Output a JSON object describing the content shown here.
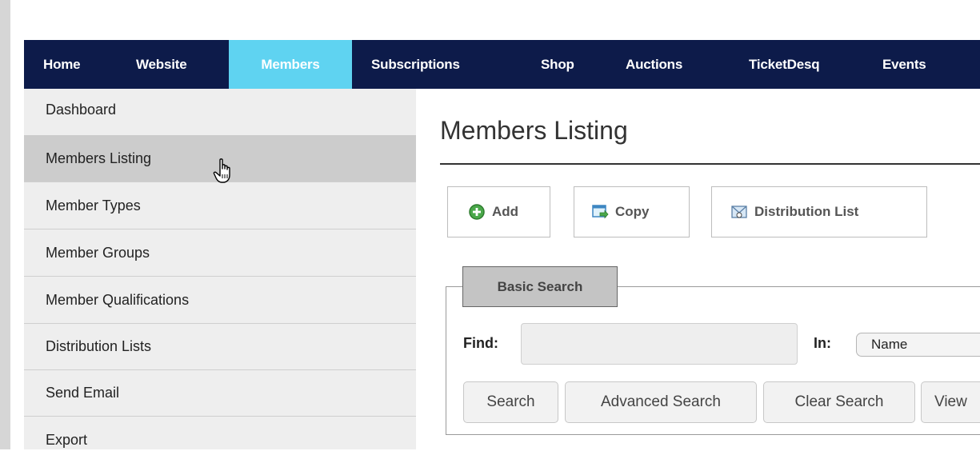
{
  "nav": {
    "items": [
      {
        "label": "Home",
        "active": false
      },
      {
        "label": "Website",
        "active": false
      },
      {
        "label": "Members",
        "active": true
      },
      {
        "label": "Subscriptions",
        "active": false
      },
      {
        "label": "Shop",
        "active": false
      },
      {
        "label": "Auctions",
        "active": false
      },
      {
        "label": "TicketDesq",
        "active": false
      },
      {
        "label": "Events",
        "active": false
      }
    ]
  },
  "sidebar": {
    "items": [
      {
        "label": "Dashboard"
      },
      {
        "label": "Members Listing",
        "active": true
      },
      {
        "label": "Member Types"
      },
      {
        "label": "Member Groups"
      },
      {
        "label": "Member Qualifications"
      },
      {
        "label": "Distribution Lists"
      },
      {
        "label": "Send Email"
      },
      {
        "label": "Export"
      }
    ]
  },
  "main": {
    "title": "Members Listing",
    "toolbar": {
      "add": "Add",
      "copy": "Copy",
      "distribution_list": "Distribution List"
    },
    "search": {
      "legend": "Basic Search",
      "find_label": "Find:",
      "find_value": "",
      "in_label": "In:",
      "in_value": "Name",
      "buttons": {
        "search": "Search",
        "advanced": "Advanced Search",
        "clear": "Clear Search",
        "view": "View"
      }
    }
  },
  "colors": {
    "nav_bg": "#0d1b4a",
    "nav_active": "#5fd3f1",
    "sidebar_bg": "#eeeeee",
    "sidebar_active": "#cccccc"
  },
  "icons": {
    "add": "plus-circle-icon",
    "copy": "copy-icon",
    "distribution_list": "mail-list-icon",
    "cursor": "hand-pointer-icon"
  }
}
